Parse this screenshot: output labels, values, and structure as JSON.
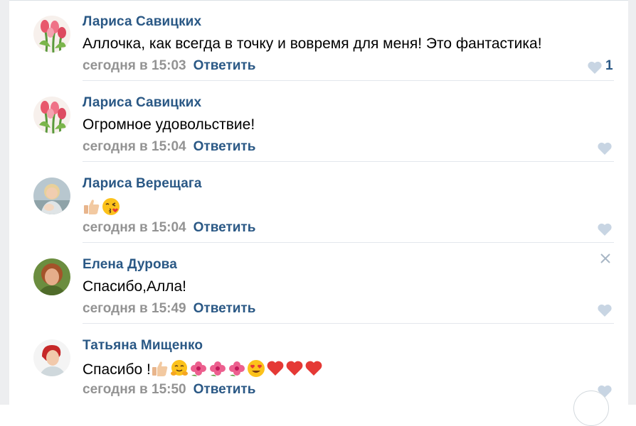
{
  "comments": [
    {
      "author": "Лариса Савицких",
      "text": "Аллочка, как всегда в точку и вовремя для меня! Это фантастика!",
      "date": "сегодня в 15:03",
      "reply": "Ответить",
      "likes": "1",
      "avatar": "tulips-avatar"
    },
    {
      "author": "Лариса Савицких",
      "text": "Огромное удовольствие!",
      "date": "сегодня в 15:04",
      "reply": "Ответить",
      "avatar": "tulips-avatar"
    },
    {
      "author": "Лариса Верещага",
      "text": "",
      "date": "сегодня в 15:04",
      "reply": "Ответить",
      "avatar": "woman-photo-avatar",
      "emojis": [
        "thumbs-up-emoji",
        "kiss-face-emoji"
      ]
    },
    {
      "author": "Елена Дурова",
      "text": "Спасибо,Алла!",
      "date": "сегодня в 15:49",
      "reply": "Ответить",
      "avatar": "woman-photo-avatar"
    },
    {
      "author": "Татьяна Мищенко",
      "text": "Спасибо !",
      "date": "сегодня в 15:50",
      "reply": "Ответить",
      "avatar": "woman-photo-avatar",
      "emojis": [
        "thumbs-up-emoji",
        "hugging-face-emoji",
        "flower-emoji",
        "flower-emoji",
        "flower-emoji",
        "heart-eyes-emoji",
        "heart-emoji",
        "heart-emoji",
        "heart-emoji"
      ]
    }
  ],
  "colors": {
    "link": "#2a5885",
    "meta": "#939393",
    "separator": "#e3e7ec",
    "like_icon": "#c8d5e3"
  },
  "icons": {
    "like": "heart-icon",
    "delete": "close-icon",
    "scroll": "scroll-down-button"
  }
}
